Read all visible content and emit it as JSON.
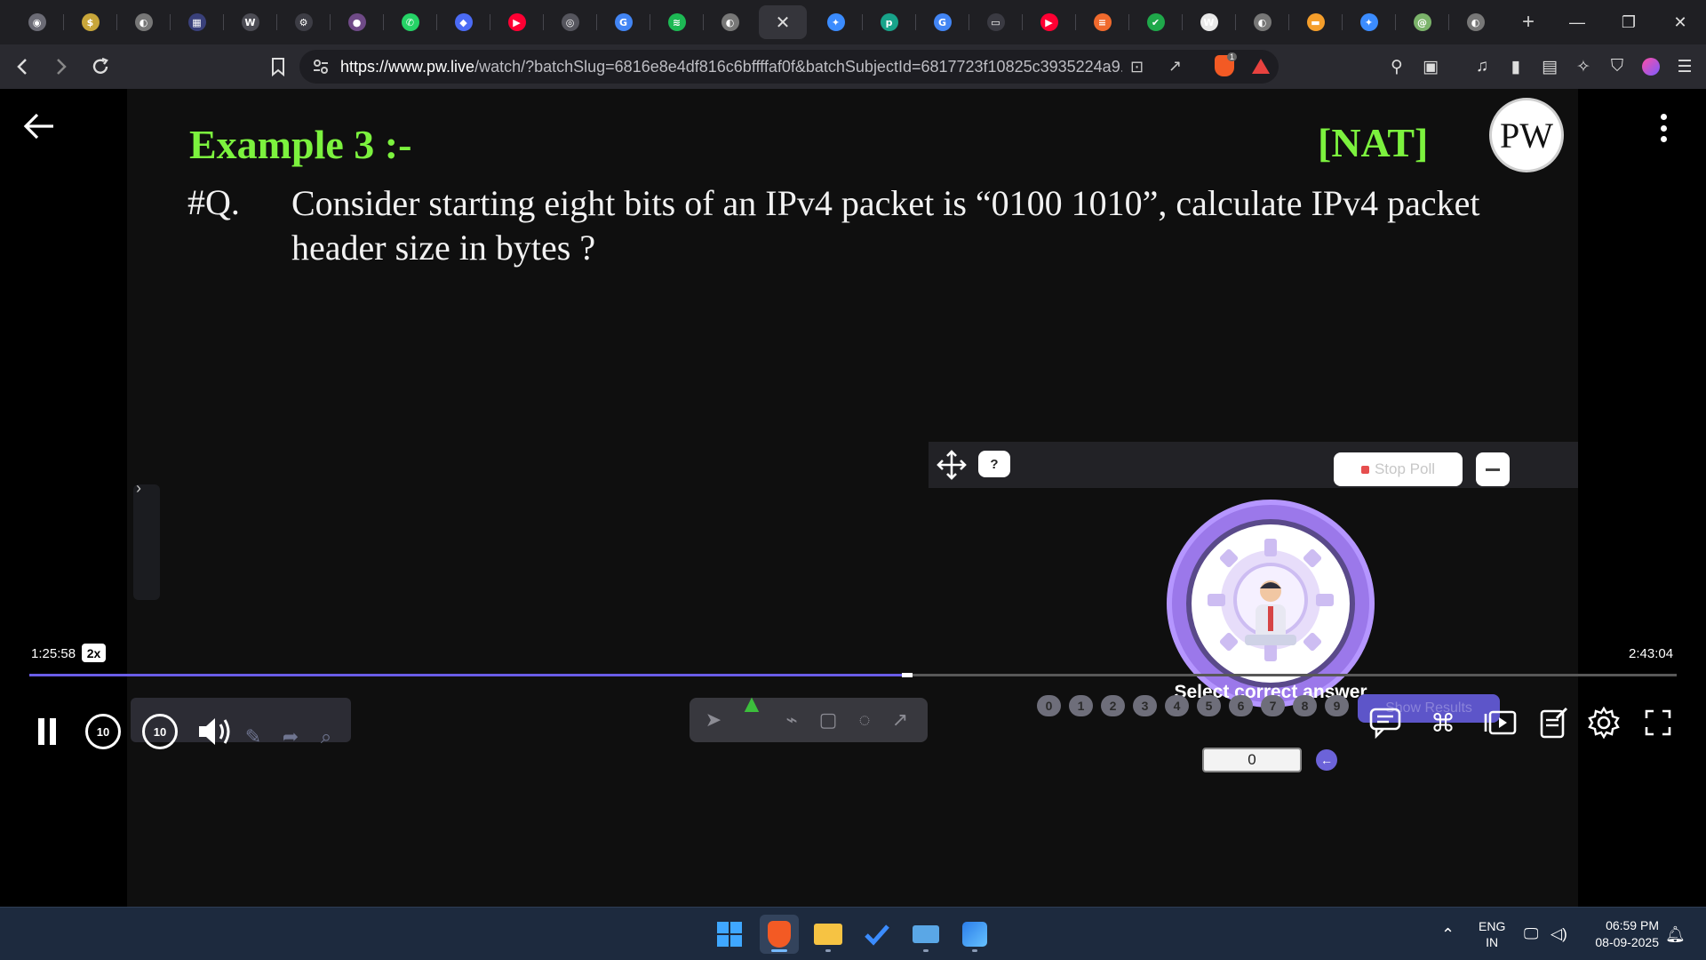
{
  "browser": {
    "tabs": [
      {
        "icon": "app-icon",
        "color": "#6b6b75",
        "glyph": "◉"
      },
      {
        "icon": "coin-icon",
        "color": "#c8a63a",
        "glyph": "$"
      },
      {
        "icon": "globe-icon",
        "color": "#777",
        "glyph": "◐"
      },
      {
        "icon": "box-icon",
        "color": "#39407a",
        "glyph": "▦"
      },
      {
        "icon": "w3-icon",
        "color": "#4c4c54",
        "glyph": "W"
      },
      {
        "icon": "gear-site-icon",
        "color": "#3d3d45",
        "glyph": "⚙"
      },
      {
        "icon": "purple-site-icon",
        "color": "#6f4a87",
        "glyph": "●"
      },
      {
        "icon": "whatsapp-icon",
        "color": "#25d366",
        "glyph": "✆"
      },
      {
        "icon": "bookmark-site-icon",
        "color": "#4b6bf5",
        "glyph": "◆"
      },
      {
        "icon": "youtube-icon",
        "color": "#ff0033",
        "glyph": "▶"
      },
      {
        "icon": "school-site-icon",
        "color": "#55555d",
        "glyph": "◎"
      },
      {
        "icon": "google-icon",
        "color": "#4285f4",
        "glyph": "G"
      },
      {
        "icon": "spotify-icon",
        "color": "#1db954",
        "glyph": "≋"
      },
      {
        "icon": "globe-icon",
        "color": "#777",
        "glyph": "◐"
      }
    ],
    "tabs_after": [
      {
        "icon": "gemini-icon",
        "color": "#3b8cff",
        "glyph": "✦"
      },
      {
        "icon": "pw-site-icon",
        "color": "#18a38a",
        "glyph": "p"
      },
      {
        "icon": "google-icon",
        "color": "#4285f4",
        "glyph": "G"
      },
      {
        "icon": "monitor-icon",
        "color": "#3a3a42",
        "glyph": "▭"
      },
      {
        "icon": "youtube-icon",
        "color": "#ff0033",
        "glyph": "▶"
      },
      {
        "icon": "orange-site-icon",
        "color": "#f06a2d",
        "glyph": "≡"
      },
      {
        "icon": "green-site-icon",
        "color": "#1fa84a",
        "glyph": "✔"
      },
      {
        "icon": "wikipedia-icon",
        "color": "#e9e9e9",
        "glyph": "W"
      },
      {
        "icon": "globe-icon",
        "color": "#777",
        "glyph": "◐"
      },
      {
        "icon": "flag-icon",
        "color": "#f59e2b",
        "glyph": "▬"
      },
      {
        "icon": "gemini-icon",
        "color": "#3b8cff",
        "glyph": "✦"
      },
      {
        "icon": "green-avatar-icon",
        "color": "#7bb36a",
        "glyph": "@"
      },
      {
        "icon": "globe-icon",
        "color": "#777",
        "glyph": "◐"
      }
    ],
    "active_tab_close": "✕",
    "url_host": "https://www.pw.live",
    "url_rest": "/watch/?batchSlug=6816e8e4df816c6bffffaf0f&batchSubjectId=6817723f10825c3935224a9...",
    "brave_badge": "1"
  },
  "lecture": {
    "title": "Example 3 :-",
    "tag": "[NAT]",
    "logo_text": "PW",
    "question_label": "#Q.",
    "question_text": "Consider starting eight bits of an IPv4 packet is “0100 1010”, calculate IPv4 packet header size in bytes ?"
  },
  "poll": {
    "help": "?",
    "stop_label": "Stop Poll",
    "caption": "Select correct answer",
    "answer_value": "0",
    "send_glyph": "←",
    "digits": [
      "0",
      "1",
      "2",
      "3",
      "4",
      "5",
      "6",
      "7",
      "8",
      "9"
    ],
    "results_label": "Show Results"
  },
  "player": {
    "current_time": "1:25:58",
    "speed": "2x",
    "total_time": "2:43:04",
    "progress": 0.5296,
    "skip_back": "10",
    "skip_fwd": "10"
  },
  "taskbar": {
    "language": "ENG",
    "region": "IN",
    "time": "06:59 PM",
    "date": "08-09-2025"
  }
}
